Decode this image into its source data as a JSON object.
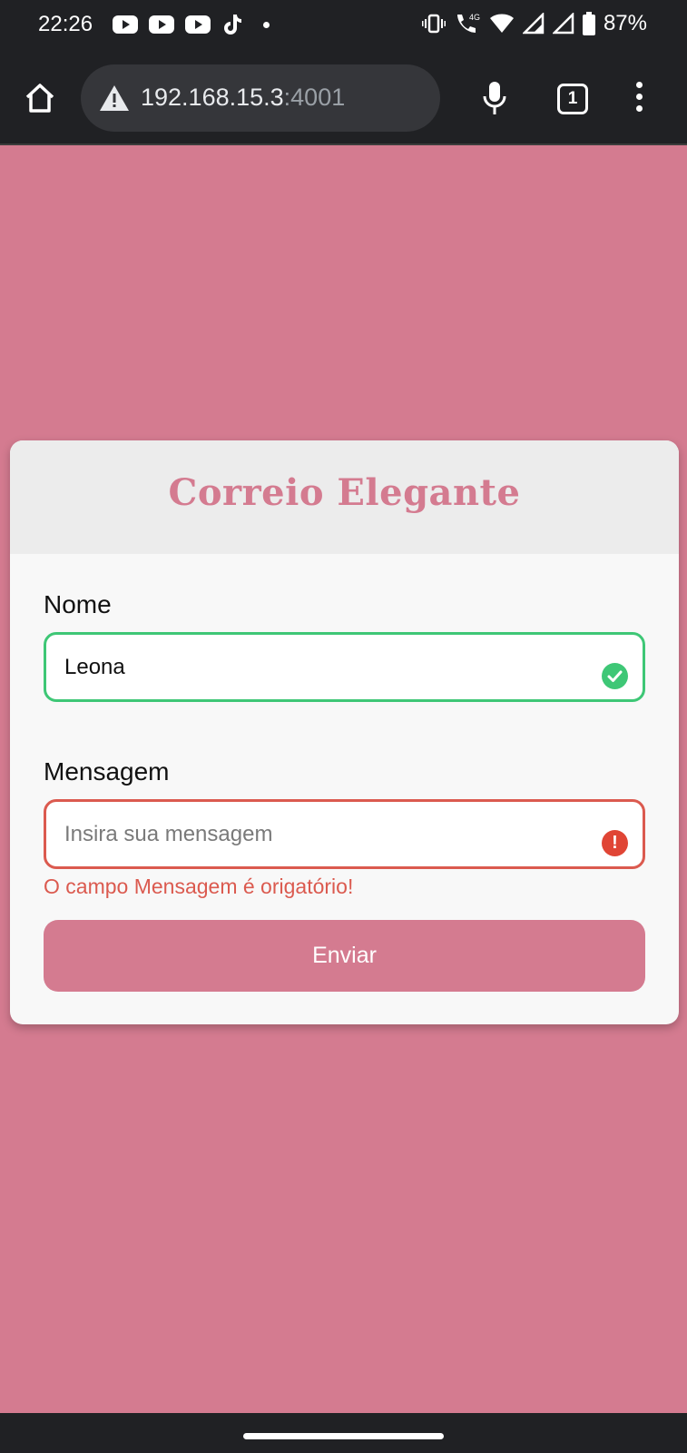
{
  "status_bar": {
    "time": "22:26",
    "battery_percent": "87%",
    "icons": [
      "youtube-icon",
      "youtube-icon",
      "youtube-icon",
      "tiktok-icon",
      "dot-icon",
      "vibrate-icon",
      "wifi-calling-icon",
      "wifi-icon",
      "signal-icon",
      "signal-icon",
      "battery-icon"
    ],
    "network_label": "4G"
  },
  "browser": {
    "url_host": "192.168.15.3",
    "url_port": ":4001",
    "tab_count": "1",
    "icons": [
      "home-icon",
      "warning-icon",
      "mic-icon",
      "tabs-icon",
      "more-menu-icon"
    ]
  },
  "form": {
    "title": "Correio Elegante",
    "name_label": "Nome",
    "name_value": "Leona",
    "message_label": "Mensagem",
    "message_placeholder": "Insira sua mensagem",
    "message_error": "O campo Mensagem é origatório!",
    "submit_label": "Enviar",
    "alert_glyph": "!"
  },
  "colors": {
    "background": "#d47b90",
    "title": "#d47b90",
    "valid_border": "#3ec776",
    "error_border": "#db5a4f",
    "error_icon": "#e04535",
    "system_bar": "#202124"
  }
}
